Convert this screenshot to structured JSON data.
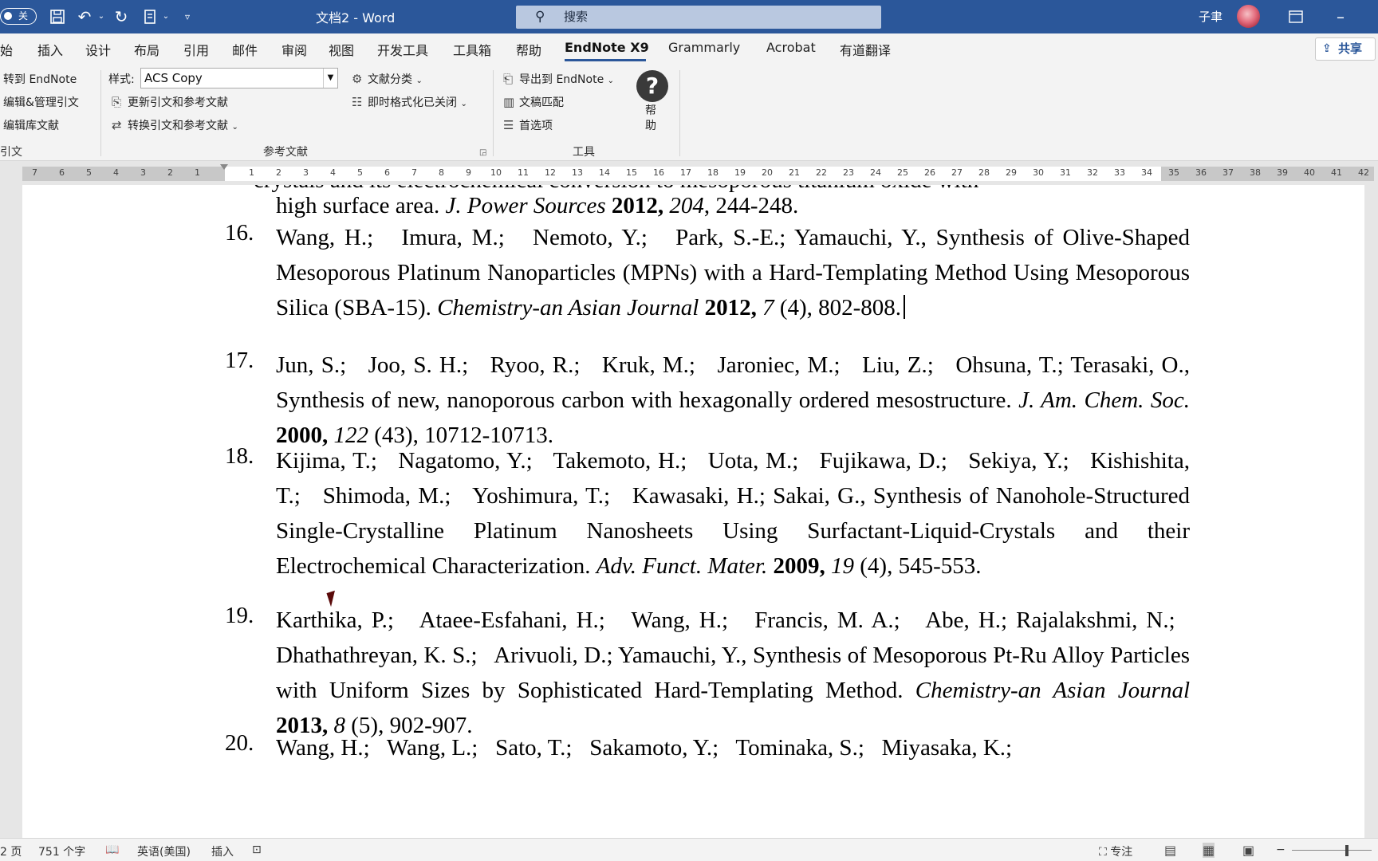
{
  "titlebar": {
    "autosave_label": "关",
    "title": "文档2 - Word",
    "search_placeholder": "搜索",
    "user_name": "子聿"
  },
  "menu": {
    "items": [
      "始",
      "插入",
      "设计",
      "布局",
      "引用",
      "邮件",
      "审阅",
      "视图",
      "开发工具",
      "工具箱",
      "帮助",
      "EndNote X9",
      "Grammarly",
      "Acrobat",
      "有道翻译"
    ],
    "active": "EndNote X9",
    "share_label": "共享"
  },
  "ribbon": {
    "citations_group": {
      "go_to_endnote": "转到 EndNote",
      "edit_manage": "编辑&管理引文",
      "edit_library": "编辑库文献",
      "label": "引文"
    },
    "bibliography_group": {
      "style_label": "样式:",
      "style_value": "ACS Copy",
      "update": "更新引文和参考文献",
      "convert": "转换引文和参考文献",
      "categorize": "文献分类",
      "instant_format": "即时格式化已关闭",
      "label": "参考文献"
    },
    "tools_group": {
      "export": "导出到 EndNote",
      "manuscript_match": "文稿匹配",
      "preferences": "首选项",
      "label": "工具"
    },
    "help": {
      "label": "帮助"
    }
  },
  "ruler": {
    "left_numbers": [
      "7",
      "6",
      "5",
      "4",
      "3",
      "2",
      "1"
    ],
    "right_numbers": [
      "1",
      "2",
      "3",
      "4",
      "5",
      "6",
      "7",
      "8",
      "9",
      "10",
      "11",
      "12",
      "13",
      "14",
      "15",
      "16",
      "17",
      "18",
      "19",
      "20",
      "21",
      "22",
      "23",
      "24",
      "25",
      "26",
      "27",
      "28",
      "29",
      "30",
      "31",
      "32",
      "33",
      "34",
      "35",
      "36",
      "37",
      "38",
      "39",
      "40",
      "41",
      "42"
    ]
  },
  "document": {
    "top_cut_line": "crystals and its electrochemical conversion to mesoporous titanium oxide with",
    "references": [
      {
        "num": "",
        "html": "high surface area. <i>J. Power Sources</i> <b>2012,</b> <i>204</i>, 244-248."
      },
      {
        "num": "16.",
        "html": "Wang, H.;&nbsp;&nbsp; Imura, M.;&nbsp;&nbsp; Nemoto, Y.;&nbsp;&nbsp; Park, S.-E.; Yamauchi, Y., Synthesis of Olive-Shaped Mesoporous Platinum Nanoparticles (MPNs) with a Hard-Templating Method Using Mesoporous Silica (SBA-15). <i>Chemistry-an Asian Journal</i> <b>2012,</b> <i>7</i> (4), 802-808."
      },
      {
        "num": "17.",
        "html": "Jun, S.;&nbsp;&nbsp; Joo, S. H.;&nbsp;&nbsp; Ryoo, R.;&nbsp;&nbsp; Kruk, M.;&nbsp;&nbsp; Jaroniec, M.;&nbsp;&nbsp; Liu, Z.;&nbsp;&nbsp; Ohsuna, T.; Terasaki, O., Synthesis of new, nanoporous carbon with hexagonally ordered mesostructure. <i>J. Am. Chem. Soc.</i> <b>2000,</b> <i>122</i> (43), 10712-10713."
      },
      {
        "num": "18.",
        "html": "Kijima, T.;&nbsp;&nbsp; Nagatomo, Y.;&nbsp;&nbsp; Takemoto, H.;&nbsp;&nbsp; Uota, M.;&nbsp;&nbsp; Fujikawa, D.;&nbsp;&nbsp; Sekiya, Y.;&nbsp;&nbsp; Kishishita, T.;&nbsp;&nbsp; Shimoda, M.;&nbsp;&nbsp; Yoshimura, T.;&nbsp;&nbsp; Kawasaki, H.; Sakai, G., Synthesis of Nanohole-Structured Single-Crystalline Platinum Nanosheets Using Surfactant-Liquid-Crystals and their Electrochemical Characterization. <i>Adv. Funct. Mater.</i> <b>2009,</b> <i>19</i> (4), 545-553."
      },
      {
        "num": "19.",
        "html": "Karthika, P.;&nbsp;&nbsp; Ataee-Esfahani, H.;&nbsp;&nbsp; Wang, H.;&nbsp;&nbsp; Francis, M. A.;&nbsp;&nbsp; Abe, H.; Rajalakshmi, N.;&nbsp;&nbsp; Dhathathreyan, K. S.;&nbsp;&nbsp; Arivuoli, D.; Yamauchi, Y., Synthesis of Mesoporous Pt-Ru Alloy Particles with Uniform Sizes by Sophisticated Hard-Templating Method. <i>Chemistry-an Asian Journal</i> <b>2013,</b> <i>8</i> (5), 902-907."
      },
      {
        "num": "20.",
        "html": "Wang, H.;&nbsp;&nbsp; Wang, L.;&nbsp;&nbsp; Sato, T.;&nbsp;&nbsp; Sakamoto, Y.;&nbsp;&nbsp; Tominaka, S.;&nbsp;&nbsp; Miyasaka, K.;"
      }
    ]
  },
  "statusbar": {
    "page": "2 页",
    "word_count": "751 个字",
    "language": "英语(美国)",
    "mode": "插入",
    "focus": "专注"
  }
}
